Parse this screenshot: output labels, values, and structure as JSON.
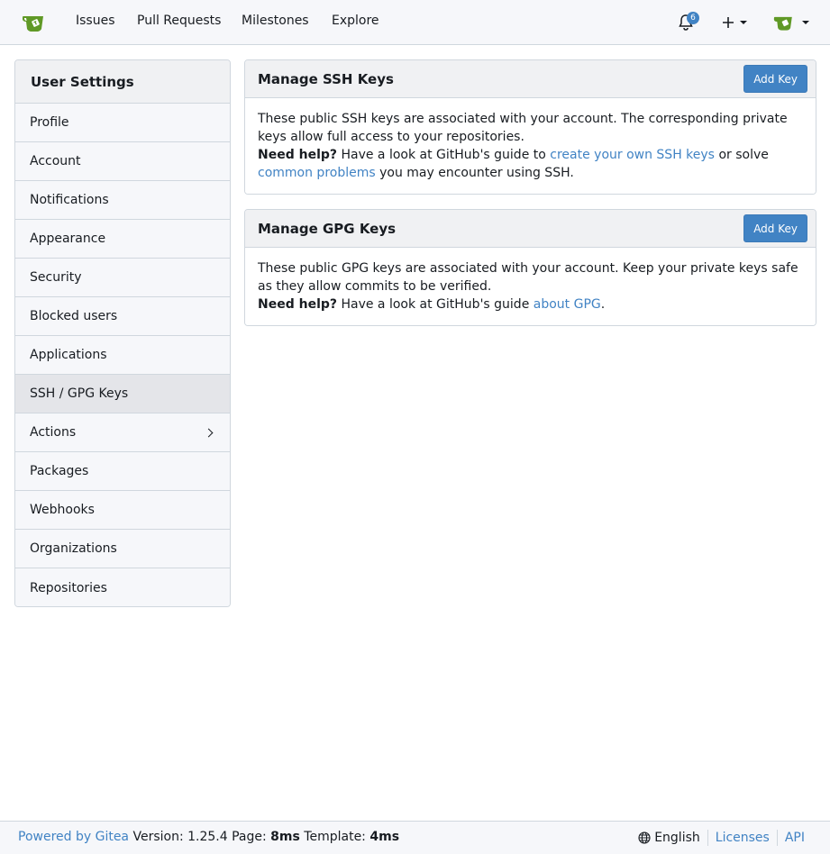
{
  "navbar": {
    "links": [
      "Issues",
      "Pull Requests",
      "Milestones",
      "Explore"
    ],
    "notification_count": "6"
  },
  "sidebar": {
    "title": "User Settings",
    "items": [
      {
        "label": "Profile"
      },
      {
        "label": "Account"
      },
      {
        "label": "Notifications"
      },
      {
        "label": "Appearance"
      },
      {
        "label": "Security"
      },
      {
        "label": "Blocked users"
      },
      {
        "label": "Applications"
      },
      {
        "label": "SSH / GPG Keys",
        "active": true
      },
      {
        "label": "Actions",
        "has_submenu": true
      },
      {
        "label": "Packages"
      },
      {
        "label": "Webhooks"
      },
      {
        "label": "Organizations"
      },
      {
        "label": "Repositories"
      }
    ]
  },
  "ssh_panel": {
    "title": "Manage SSH Keys",
    "add_button": "Add Key",
    "description": "These public SSH keys are associated with your account. The corresponding private keys allow full access to your repositories.",
    "help_label": "Need help?",
    "help_text_1": "Have a look at GitHub's guide to",
    "help_link_1": "create your own SSH keys",
    "help_text_2": "or solve",
    "help_link_2": "common problems",
    "help_text_3": "you may encounter using SSH."
  },
  "gpg_panel": {
    "title": "Manage GPG Keys",
    "add_button": "Add Key",
    "description": "These public GPG keys are associated with your account. Keep your private keys safe as they allow commits to be verified.",
    "help_label": "Need help?",
    "help_text_1": "Have a look at GitHub's guide",
    "help_link_1": "about GPG",
    "help_text_2": "."
  },
  "footer": {
    "powered_by": "Powered by Gitea",
    "version": "Version: 1.25.4",
    "page_label": "Page:",
    "page_time": "8ms",
    "template_label": "Template:",
    "template_time": "4ms",
    "language": "English",
    "licenses": "Licenses",
    "api": "API"
  },
  "colors": {
    "accent": "#4183c4",
    "logo_green": "#609926"
  }
}
